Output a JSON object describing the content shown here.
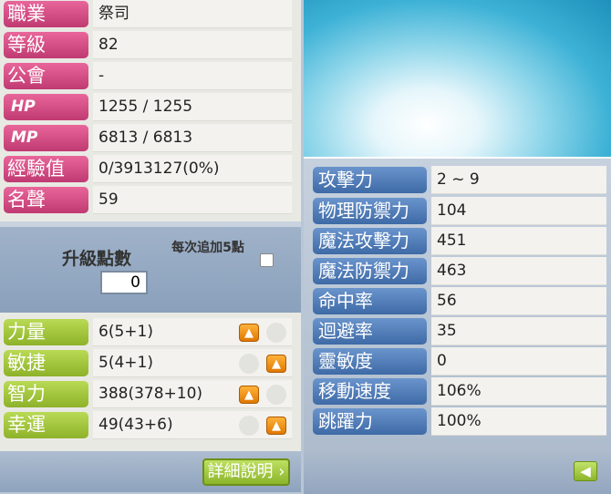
{
  "char_info": [
    {
      "label": "職業",
      "value": "祭司",
      "style": "pink"
    },
    {
      "label": "等級",
      "value": "82",
      "style": "pink"
    },
    {
      "label": "公會",
      "value": "-",
      "style": "pink"
    },
    {
      "label": "HP",
      "value": "1255 / 1255",
      "style": "pink"
    },
    {
      "label": "MP",
      "value": "6813 / 6813",
      "style": "pink"
    },
    {
      "label": "經驗值",
      "value": "0/3913127(0%)",
      "style": "pink"
    },
    {
      "label": "名聲",
      "value": "59",
      "style": "pink"
    }
  ],
  "ap": {
    "label": "升級點數",
    "value": "0",
    "auto_label": "每次追加5點"
  },
  "base_stats": [
    {
      "label": "力量",
      "value": "6(5+1)"
    },
    {
      "label": "敏捷",
      "value": "5(4+1)"
    },
    {
      "label": "智力",
      "value": "388(378+10)"
    },
    {
      "label": "幸運",
      "value": "49(43+6)"
    }
  ],
  "detail_button": "詳細說明",
  "combat_stats": [
    {
      "label": "攻擊力",
      "value": "2 ~ 9"
    },
    {
      "label": "物理防禦力",
      "value": "104"
    },
    {
      "label": "魔法攻擊力",
      "value": "451"
    },
    {
      "label": "魔法防禦力",
      "value": "463"
    },
    {
      "label": "命中率",
      "value": "56"
    },
    {
      "label": "迴避率",
      "value": "35"
    },
    {
      "label": "靈敏度",
      "value": "0"
    },
    {
      "label": "移動速度",
      "value": "106%"
    },
    {
      "label": "跳躍力",
      "value": "100%"
    }
  ],
  "colors": {
    "pink_tag": "#d04f86",
    "green_tag": "#a3c83e",
    "blue_tag": "#5280bb",
    "up_button": "#f08c10"
  },
  "icons": {
    "up_button": "arrow-up-icon",
    "back_button": "arrow-left-icon"
  }
}
